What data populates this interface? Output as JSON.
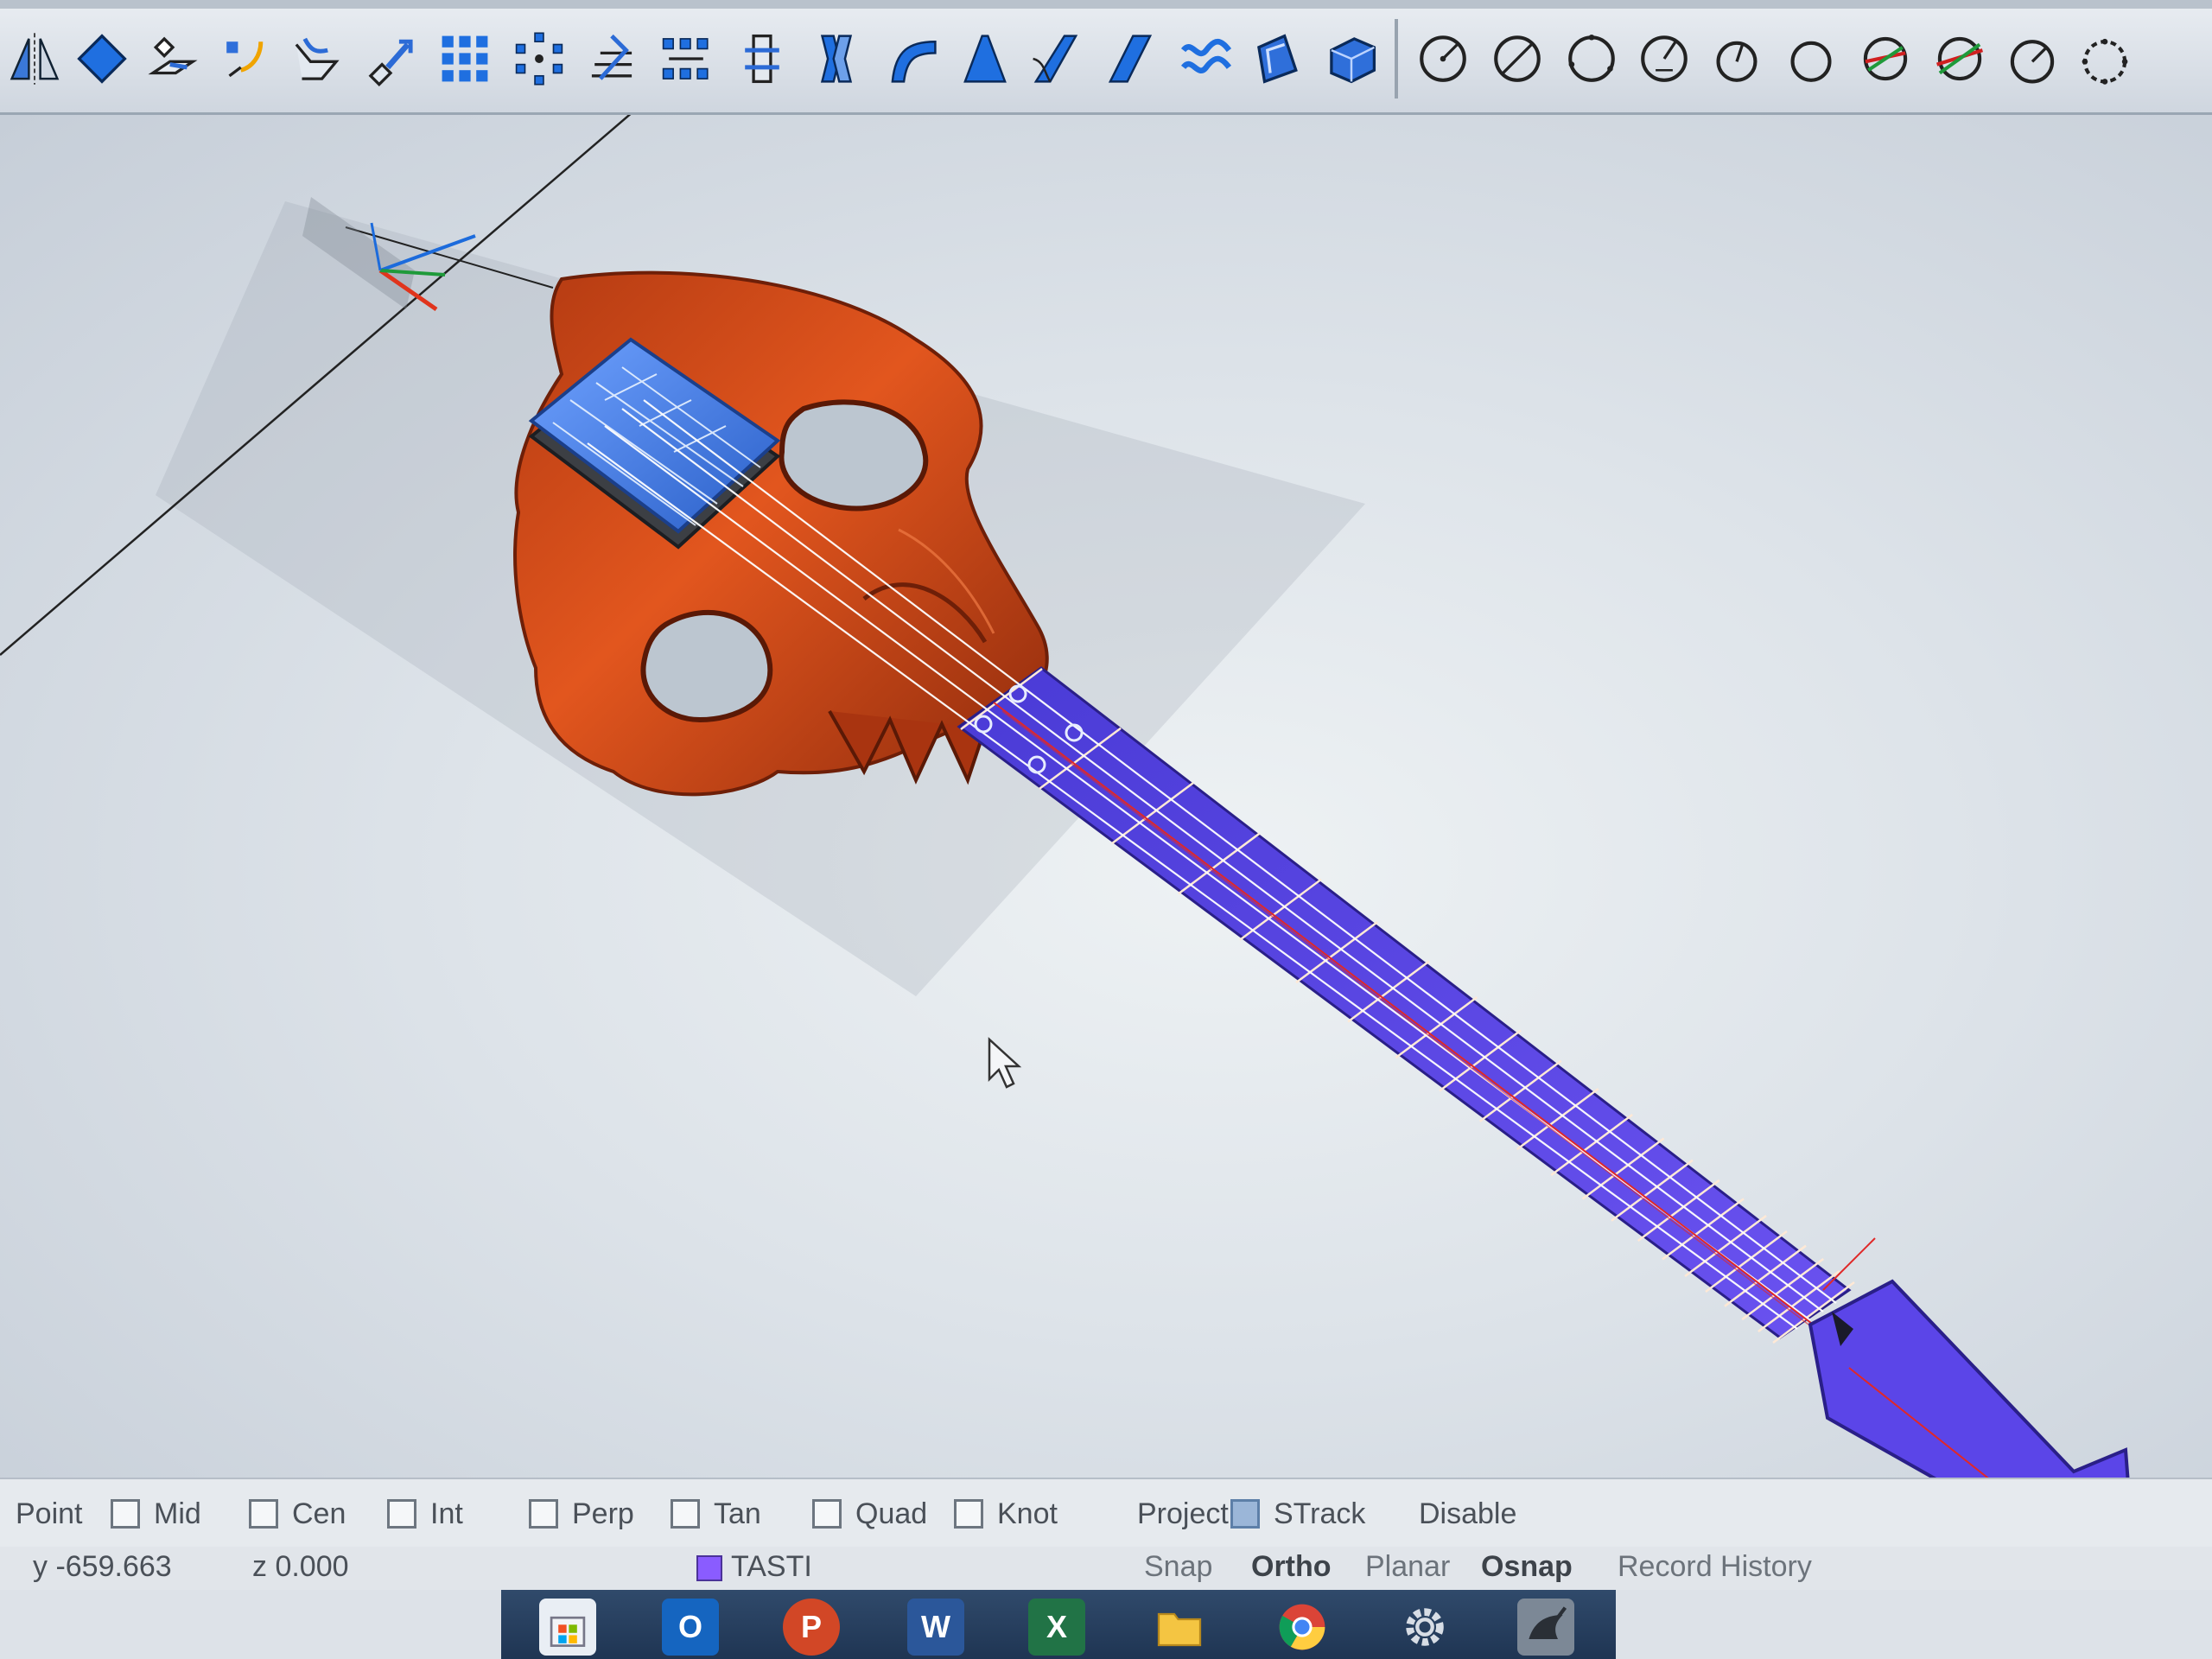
{
  "toolbar": {
    "buttons": [
      {
        "name": "mirror-icon"
      },
      {
        "name": "diamond-solid-icon"
      },
      {
        "name": "set-cplane-icon"
      },
      {
        "name": "extend-icon"
      },
      {
        "name": "sweep-icon"
      },
      {
        "name": "rotate-3d-icon"
      },
      {
        "name": "array-grid-icon"
      },
      {
        "name": "array-polar-icon"
      },
      {
        "name": "contour-icon"
      },
      {
        "name": "array-along-curve-icon"
      },
      {
        "name": "split-icon"
      },
      {
        "name": "twist-icon"
      },
      {
        "name": "bend-icon"
      },
      {
        "name": "taper-icon"
      },
      {
        "name": "flow-along-curve-icon"
      },
      {
        "name": "shear-icon"
      },
      {
        "name": "smooth-icon"
      },
      {
        "name": "cage-edit-icon"
      },
      {
        "name": "box-cage-icon"
      },
      {
        "name": "circle-center-icon"
      },
      {
        "name": "circle-diameter-icon"
      },
      {
        "name": "circle-3pt-icon"
      },
      {
        "name": "circle-tangent-icon"
      },
      {
        "name": "circle-around-curve-icon"
      },
      {
        "name": "circle-plain-icon"
      },
      {
        "name": "circle-vertical-icon"
      },
      {
        "name": "circle-tangent-3-icon"
      },
      {
        "name": "circle-fit-icon"
      },
      {
        "name": "circle-deformable-icon"
      }
    ]
  },
  "osnap": {
    "items": [
      {
        "label": "Point",
        "checked": false
      },
      {
        "label": "Mid",
        "checked": false
      },
      {
        "label": "Cen",
        "checked": false
      },
      {
        "label": "Int",
        "checked": false
      },
      {
        "label": "Perp",
        "checked": false
      },
      {
        "label": "Tan",
        "checked": false
      },
      {
        "label": "Quad",
        "checked": false
      },
      {
        "label": "Knot",
        "checked": false
      },
      {
        "label": "Project",
        "checked": false
      },
      {
        "label": "STrack",
        "checked": true
      },
      {
        "label": "Disable",
        "checked": false
      }
    ]
  },
  "status": {
    "y_coord": "y -659.663",
    "z_coord": "z 0.000",
    "layer": "TASTI",
    "layer_color": "#8a5cff",
    "panes": [
      {
        "label": "Snap",
        "bold": false
      },
      {
        "label": "Ortho",
        "bold": true
      },
      {
        "label": "Planar",
        "bold": false
      },
      {
        "label": "Osnap",
        "bold": true
      },
      {
        "label": "Record History",
        "bold": false
      }
    ]
  },
  "taskbar": {
    "apps": [
      {
        "name": "store-app-icon",
        "color": "#e9eef4"
      },
      {
        "name": "outlook-app-icon",
        "color": "#1565c0",
        "glyph": "O"
      },
      {
        "name": "powerpoint-app-icon",
        "color": "#d24726",
        "glyph": "P"
      },
      {
        "name": "word-app-icon",
        "color": "#2b579a",
        "glyph": "W"
      },
      {
        "name": "excel-app-icon",
        "color": "#217346",
        "glyph": "X"
      },
      {
        "name": "file-explorer-app-icon",
        "color": "#f4c542"
      },
      {
        "name": "chrome-app-icon",
        "color": "#db4437"
      },
      {
        "name": "settings-app-icon",
        "color": "#5b6775"
      },
      {
        "name": "rhino-app-icon",
        "color": "#7c8896"
      }
    ]
  },
  "colors": {
    "skull": "#c84416",
    "neck": "#5a44e6",
    "frets": "#ffe9d6",
    "strings": "#ffffff",
    "headstock": "#4a7ee0"
  }
}
